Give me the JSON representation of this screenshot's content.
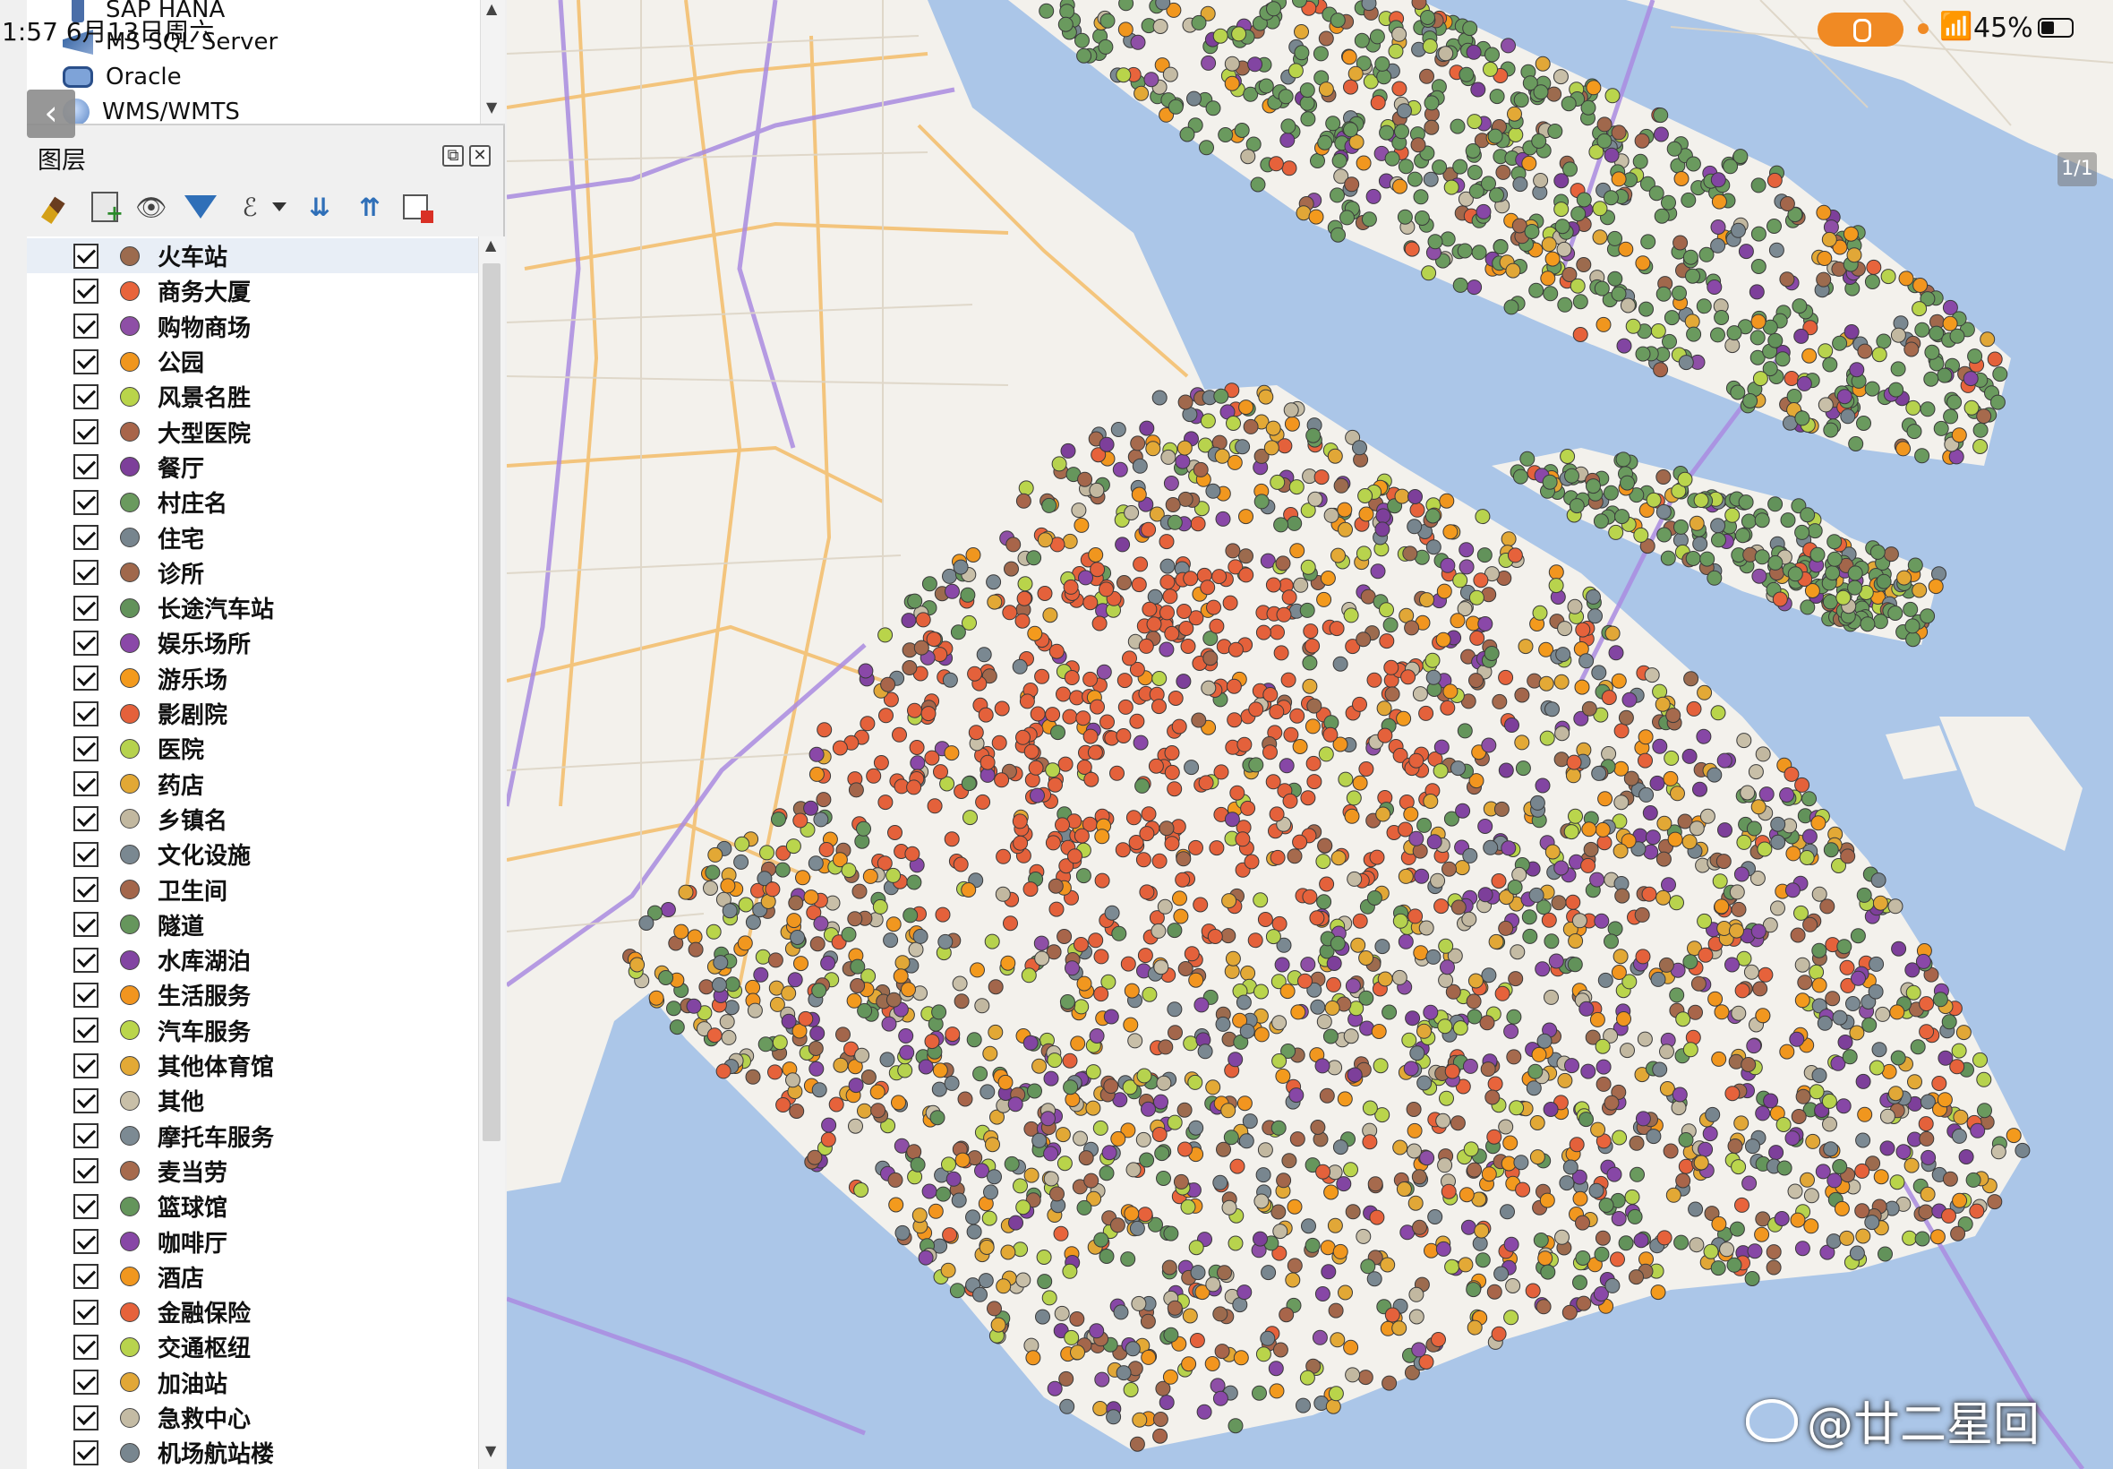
{
  "status_bar": {
    "time_date": "1:57  6月13日周六",
    "battery_percent": "45%",
    "page_indicator": "1/1"
  },
  "browser_panel": {
    "items": [
      {
        "label": "SAP HANA",
        "icon": "database-icon"
      },
      {
        "label": "MS SQL Server",
        "icon": "mssql-icon"
      },
      {
        "label": "Oracle",
        "icon": "oracle-icon"
      },
      {
        "label": "WMS/WMTS",
        "icon": "globe-icon"
      }
    ]
  },
  "layers_panel": {
    "title": "图层",
    "toolbar": [
      "style-manager-icon",
      "add-group-icon",
      "visibility-eye-icon",
      "filter-legend-icon",
      "expression-filter-icon",
      "expand-all-icon",
      "collapse-all-icon",
      "remove-layer-icon"
    ],
    "layers": [
      {
        "name": "火车站",
        "color": "#9c6b4e",
        "checked": true
      },
      {
        "name": "商务大厦",
        "color": "#e8643c",
        "checked": true
      },
      {
        "name": "购物商场",
        "color": "#8e4fa6",
        "checked": true
      },
      {
        "name": "公园",
        "color": "#f0961e",
        "checked": true
      },
      {
        "name": "风景名胜",
        "color": "#b9d44a",
        "checked": true
      },
      {
        "name": "大型医院",
        "color": "#a8654a",
        "checked": true
      },
      {
        "name": "餐厅",
        "color": "#7d3f9a",
        "checked": true
      },
      {
        "name": "村庄名",
        "color": "#6a9a5e",
        "checked": true
      },
      {
        "name": "住宅",
        "color": "#77858e",
        "checked": true
      },
      {
        "name": "诊所",
        "color": "#a0684c",
        "checked": true
      },
      {
        "name": "长途汽车站",
        "color": "#62925a",
        "checked": true
      },
      {
        "name": "娱乐场所",
        "color": "#8a48a8",
        "checked": true
      },
      {
        "name": "游乐场",
        "color": "#f39a1d",
        "checked": true
      },
      {
        "name": "影剧院",
        "color": "#e4613b",
        "checked": true
      },
      {
        "name": "医院",
        "color": "#b6d24e",
        "checked": true
      },
      {
        "name": "药店",
        "color": "#e2a835",
        "checked": true
      },
      {
        "name": "乡镇名",
        "color": "#c2b8a0",
        "checked": true
      },
      {
        "name": "文化设施",
        "color": "#7a8891",
        "checked": true
      },
      {
        "name": "卫生间",
        "color": "#a3664b",
        "checked": true
      },
      {
        "name": "隧道",
        "color": "#66965c",
        "checked": true
      },
      {
        "name": "水库湖泊",
        "color": "#8245a2",
        "checked": true
      },
      {
        "name": "生活服务",
        "color": "#f2951f",
        "checked": true
      },
      {
        "name": "汽车服务",
        "color": "#bad54c",
        "checked": true
      },
      {
        "name": "其他体育馆",
        "color": "#e3a936",
        "checked": true
      },
      {
        "name": "其他",
        "color": "#c8bfa8",
        "checked": true
      },
      {
        "name": "摩托车服务",
        "color": "#7c8a93",
        "checked": true
      },
      {
        "name": "麦当劳",
        "color": "#a66a4d",
        "checked": true
      },
      {
        "name": "篮球馆",
        "color": "#64955b",
        "checked": true
      },
      {
        "name": "咖啡厅",
        "color": "#8747a6",
        "checked": true
      },
      {
        "name": "酒店",
        "color": "#f1971f",
        "checked": true
      },
      {
        "name": "金融保险",
        "color": "#e6623b",
        "checked": true
      },
      {
        "name": "交通枢纽",
        "color": "#b8d34d",
        "checked": true
      },
      {
        "name": "加油站",
        "color": "#e1a737",
        "checked": true
      },
      {
        "name": "急救中心",
        "color": "#c4bba4",
        "checked": true
      },
      {
        "name": "机场航站楼",
        "color": "#78868f",
        "checked": true
      }
    ]
  },
  "map": {
    "water_color": "#abc6e8",
    "land_color": "#f3f1ec",
    "road_major_color": "#f4c070",
    "road_highway_color": "#a98be0",
    "poi_dominant_color": "#e4613b"
  },
  "watermark": "@廿二星回"
}
